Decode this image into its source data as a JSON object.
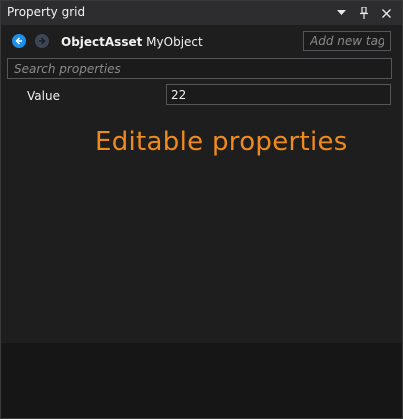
{
  "panel": {
    "title": "Property grid",
    "controls": {
      "dropdown_icon": "chevron-down-icon",
      "pin_icon": "pin-icon",
      "close_icon": "close-icon"
    }
  },
  "header": {
    "object_type": "ObjectAsset",
    "object_name": "MyObject",
    "tag_placeholder": "Add new tag",
    "back_icon": "arrow-left-icon",
    "forward_icon": "arrow-right-icon"
  },
  "search": {
    "placeholder": "Search properties"
  },
  "properties": [
    {
      "name": "Value",
      "value": "22"
    }
  ],
  "annotation": {
    "text": "Editable properties",
    "color": "#f08a1c"
  },
  "colors": {
    "accent": "#1e8fe8",
    "panel_bg": "#1e1e1f",
    "titlebar_bg": "#2d2d30"
  }
}
